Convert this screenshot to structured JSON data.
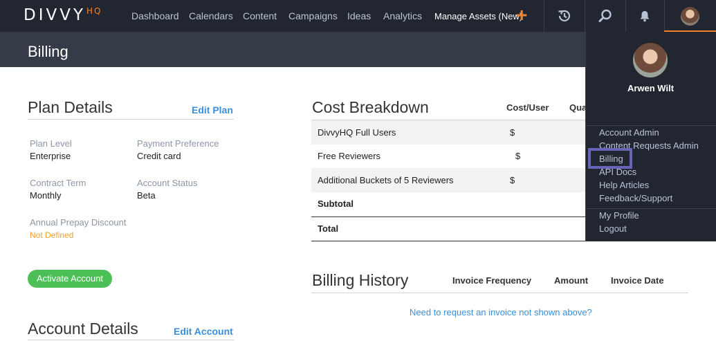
{
  "nav": {
    "logo": "DIVVY",
    "logo_suffix": "HQ",
    "items": [
      "Dashboard",
      "Calendars",
      "Content",
      "Campaigns",
      "Ideas",
      "Analytics"
    ],
    "manage_assets": "Manage Assets (New)",
    "plus": "+"
  },
  "page_title": "Billing",
  "plan": {
    "title": "Plan Details",
    "edit_label": "Edit Plan",
    "fields": [
      {
        "label": "Plan Level",
        "value": "Enterprise"
      },
      {
        "label": "Payment Preference",
        "value": "Credit card"
      },
      {
        "label": "Contract Term",
        "value": "Monthly"
      },
      {
        "label": "Account Status",
        "value": "Beta"
      },
      {
        "label": "Annual Prepay Discount",
        "value": "Not Defined"
      }
    ],
    "activate_label": "Activate Account"
  },
  "account": {
    "title": "Account Details",
    "edit_label": "Edit Account"
  },
  "cost": {
    "title": "Cost Breakdown",
    "col_cost": "Cost/User",
    "col_qty": "Qua",
    "rows": [
      {
        "name": "DivvyHQ Full Users",
        "cost": "$"
      },
      {
        "name": "Free Reviewers",
        "cost": "$"
      },
      {
        "name": "Additional Buckets of 5 Reviewers",
        "cost": "$"
      }
    ],
    "subtotal": "Subtotal",
    "total": "Total"
  },
  "history": {
    "title": "Billing History",
    "col_frequency": "Invoice Frequency",
    "col_amount": "Amount",
    "col_date": "Invoice Date",
    "request_link": "Need to request an invoice not shown above?"
  },
  "dropdown": {
    "user_name": "Arwen Wilt",
    "items": [
      "Account Admin",
      "Content Requests Admin",
      "Billing",
      "API Docs",
      "Help Articles",
      "Feedback/Support"
    ],
    "profile": "My Profile",
    "logout": "Logout"
  },
  "colors": {
    "nav_bg": "#222630",
    "title_bg": "#363b48",
    "accent": "#f4822a",
    "link": "#3a8fd9",
    "button_green": "#4cc057",
    "highlight": "#6665b8"
  }
}
